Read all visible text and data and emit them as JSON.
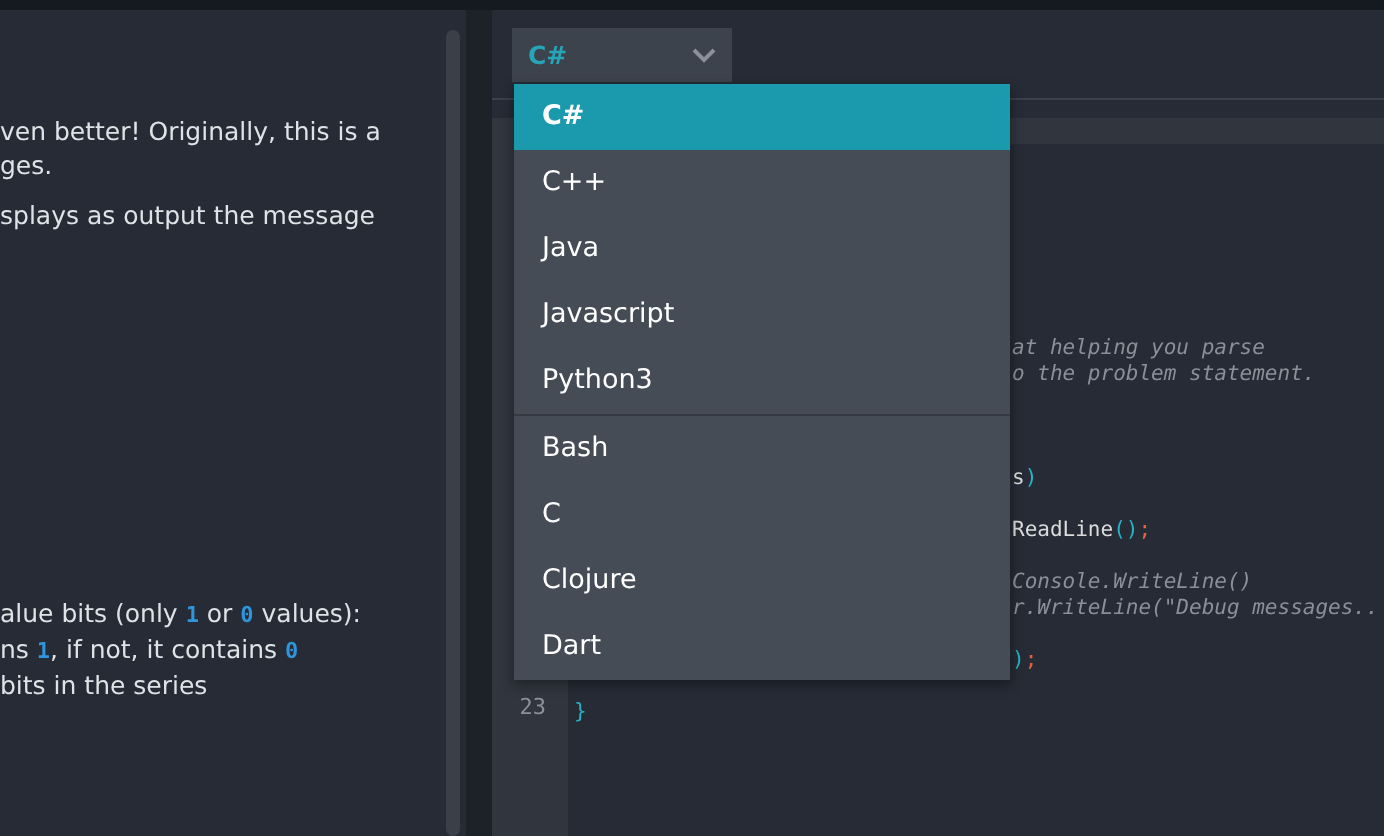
{
  "statement": {
    "paragraphs": [
      {
        "parts": [
          {
            "text": "ven better! Originally, this is a",
            "kind": "text"
          }
        ]
      },
      {
        "parts": [
          {
            "text": "ges.",
            "kind": "text"
          }
        ]
      },
      {
        "parts": [
          {
            "text": "splays as output the message",
            "kind": "text"
          }
        ]
      },
      {
        "parts": [
          {
            "text": "alue bits (only ",
            "kind": "text"
          },
          {
            "text": "1",
            "kind": "code"
          },
          {
            "text": " or ",
            "kind": "text"
          },
          {
            "text": "0",
            "kind": "code"
          },
          {
            "text": " values):",
            "kind": "text"
          }
        ]
      },
      {
        "parts": [
          {
            "text": "ns ",
            "kind": "text"
          },
          {
            "text": "1",
            "kind": "code"
          },
          {
            "text": ", if not, it contains ",
            "kind": "text"
          },
          {
            "text": "0",
            "kind": "code"
          }
        ]
      },
      {
        "parts": [
          {
            "text": "bits in the series",
            "kind": "text"
          }
        ]
      }
    ]
  },
  "language_select": {
    "value": "C#",
    "options": [
      {
        "label": "C#",
        "selected": true,
        "group_start": false
      },
      {
        "label": "C++",
        "selected": false,
        "group_start": false
      },
      {
        "label": "Java",
        "selected": false,
        "group_start": false
      },
      {
        "label": "Javascript",
        "selected": false,
        "group_start": false
      },
      {
        "label": "Python3",
        "selected": false,
        "group_start": false
      },
      {
        "label": "Bash",
        "selected": false,
        "group_start": true
      },
      {
        "label": "C",
        "selected": false,
        "group_start": false
      },
      {
        "label": "Clojure",
        "selected": false,
        "group_start": false
      },
      {
        "label": "Dart",
        "selected": false,
        "group_start": false
      }
    ]
  },
  "editor": {
    "lines": [
      {
        "kind": "covered",
        "tokens": [
          {
            "text": "at helping you parse",
            "kind": "comment"
          }
        ]
      },
      {
        "kind": "covered",
        "tokens": [
          {
            "text": "o the problem statement.",
            "kind": "comment"
          }
        ]
      },
      {
        "kind": "blank"
      },
      {
        "kind": "blank"
      },
      {
        "kind": "blank"
      },
      {
        "kind": "covered",
        "tokens": [
          {
            "text": "s",
            "kind": "plain"
          },
          {
            "text": ")",
            "kind": "punct"
          }
        ]
      },
      {
        "kind": "blank"
      },
      {
        "kind": "covered",
        "tokens": [
          {
            "text": "ReadLine",
            "kind": "plain"
          },
          {
            "text": "()",
            "kind": "punct"
          },
          {
            "text": ";",
            "kind": "semi"
          }
        ]
      },
      {
        "kind": "blank"
      },
      {
        "kind": "covered",
        "tokens": [
          {
            "text": "Console.WriteLine()",
            "kind": "comment"
          }
        ]
      },
      {
        "kind": "covered",
        "tokens": [
          {
            "text": "r.WriteLine(\"Debug messages..",
            "kind": "comment"
          }
        ]
      },
      {
        "kind": "blank"
      },
      {
        "kind": "covered",
        "tokens": [
          {
            "text": ")",
            "kind": "punct"
          },
          {
            "text": ";",
            "kind": "semi"
          }
        ]
      },
      {
        "kind": "blank"
      },
      {
        "kind": "code",
        "number": "23",
        "tokens": [
          {
            "text": "}",
            "kind": "punct"
          }
        ]
      }
    ]
  }
}
